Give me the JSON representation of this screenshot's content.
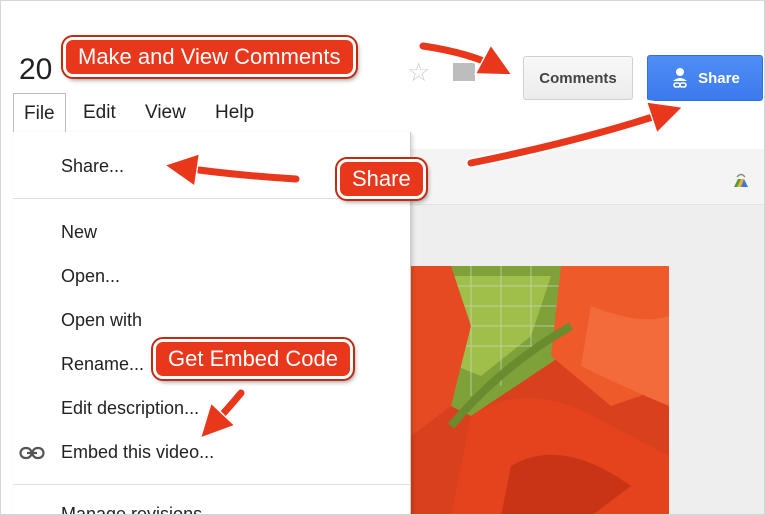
{
  "document": {
    "title": "20"
  },
  "header": {
    "comments_label": "Comments",
    "share_label": "Share"
  },
  "menubar": {
    "items": [
      {
        "label": "File"
      },
      {
        "label": "Edit"
      },
      {
        "label": "View"
      },
      {
        "label": "Help"
      }
    ]
  },
  "file_menu": {
    "items": [
      {
        "label": "Share..."
      },
      {
        "label": "New"
      },
      {
        "label": "Open..."
      },
      {
        "label": "Open with"
      },
      {
        "label": "Rename..."
      },
      {
        "label": "Edit description..."
      },
      {
        "label": "Embed this video...",
        "icon": "link-icon"
      },
      {
        "label": "Manage revisions"
      }
    ]
  },
  "annotations": {
    "comments": "Make and View Comments",
    "share": "Share",
    "embed": "Get Embed Code"
  },
  "colors": {
    "share_button": "#4285f4",
    "callout": "#e9371c"
  }
}
